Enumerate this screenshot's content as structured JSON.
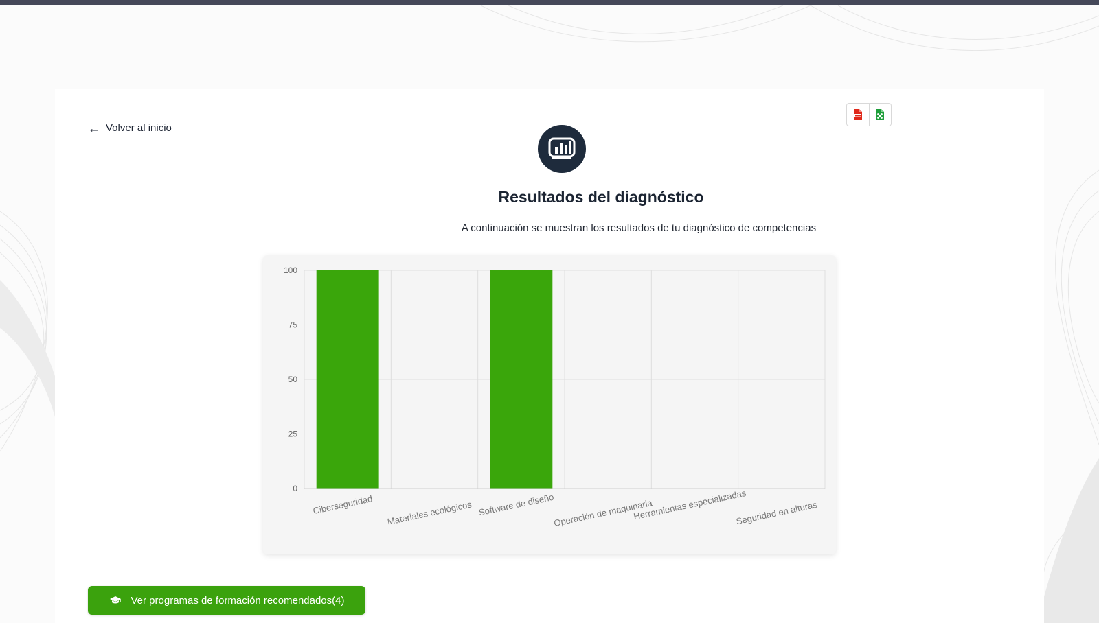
{
  "back_link": {
    "label": "Volver al inicio",
    "icon": "arrow-left-icon"
  },
  "export": {
    "pdf_icon": "pdf-file-icon",
    "excel_icon": "excel-file-icon",
    "pdf_color": "#e0291b",
    "excel_color": "#1e9e3a"
  },
  "header": {
    "icon": "bar-chart-icon",
    "title": "Resultados del diagnóstico",
    "subtitle": "A continuación se muestran los resultados de tu diagnóstico de competencias"
  },
  "chart_data": {
    "type": "bar",
    "categories": [
      "Ciberseguridad",
      "Materiales ecológicos",
      "Software de diseño",
      "Operación de maquinaria",
      "Herramientas especializadas",
      "Seguridad en alturas"
    ],
    "values": [
      100,
      0,
      100,
      0,
      0,
      0
    ],
    "ylim": [
      0,
      100
    ],
    "yticks": [
      0,
      25,
      50,
      75,
      100
    ],
    "grid": true,
    "legend": "none",
    "bar_color": "#3aa60b"
  },
  "cta": {
    "label": "Ver programas de formación recomendados(4)",
    "icon": "graduation-cap-icon",
    "color": "#3ba20d"
  }
}
